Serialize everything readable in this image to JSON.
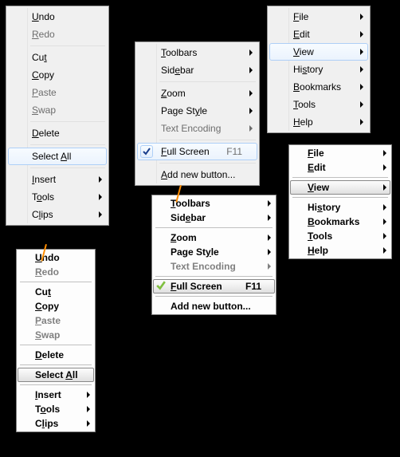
{
  "edit_menu": {
    "undo": {
      "pre": "",
      "u": "U",
      "post": "ndo"
    },
    "redo": {
      "pre": "",
      "u": "R",
      "post": "edo"
    },
    "cut": {
      "pre": "Cu",
      "u": "t",
      "post": ""
    },
    "copy": {
      "pre": "",
      "u": "C",
      "post": "opy"
    },
    "paste": {
      "pre": "",
      "u": "P",
      "post": "aste"
    },
    "swap": {
      "pre": "",
      "u": "S",
      "post": "wap"
    },
    "delete": {
      "pre": "",
      "u": "D",
      "post": "elete"
    },
    "select_all": {
      "pre": "Select ",
      "u": "A",
      "post": "ll"
    },
    "insert": {
      "pre": "",
      "u": "I",
      "post": "nsert"
    },
    "tools": {
      "pre": "T",
      "u": "o",
      "post": "ols"
    },
    "clips": {
      "pre": "C",
      "u": "l",
      "post": "ips"
    }
  },
  "view_menu": {
    "toolbars": {
      "pre": "",
      "u": "T",
      "post": "oolbars"
    },
    "sidebar": {
      "pre": "Sid",
      "u": "e",
      "post": "bar"
    },
    "zoom": {
      "pre": "",
      "u": "Z",
      "post": "oom"
    },
    "page_style": {
      "pre": "Page St",
      "u": "y",
      "post": "le"
    },
    "text_encoding": {
      "pre": "Text Encoding",
      "u": "",
      "post": ""
    },
    "full_screen": {
      "pre": "",
      "u": "F",
      "post": "ull Screen",
      "accel": "F11"
    },
    "add_new": {
      "pre": "",
      "u": "A",
      "post": "dd new button..."
    }
  },
  "top_menu": {
    "file": {
      "pre": "",
      "u": "F",
      "post": "ile"
    },
    "edit": {
      "pre": "",
      "u": "E",
      "post": "dit"
    },
    "view": {
      "pre": "",
      "u": "V",
      "post": "iew"
    },
    "history": {
      "pre": "Hi",
      "u": "s",
      "post": "tory"
    },
    "bookmarks": {
      "pre": "",
      "u": "B",
      "post": "ookmarks"
    },
    "tools": {
      "pre": "",
      "u": "T",
      "post": "ools"
    },
    "help": {
      "pre": "",
      "u": "H",
      "post": "elp"
    }
  }
}
